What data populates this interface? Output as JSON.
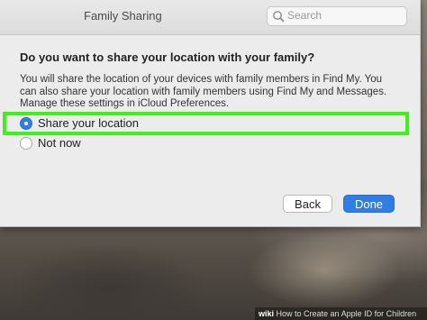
{
  "window": {
    "title": "Family Sharing",
    "search": {
      "placeholder": "Search"
    }
  },
  "prompt": {
    "heading": "Do you want to share your location with your family?",
    "description": "You will share the location of your devices with family members in Find My. You can also share your location with family members using Find My and Messages. Manage these settings in iCloud Preferences."
  },
  "options": [
    {
      "label": "Share your location",
      "selected": true
    },
    {
      "label": "Not now",
      "selected": false
    }
  ],
  "buttons": {
    "back_label": "Back",
    "done_label": "Done"
  },
  "watermark": {
    "brand": "wiki",
    "text": "How to Create an Apple ID for Children"
  },
  "colors": {
    "accent": "#2f7ee6",
    "highlight": "#3ff01a"
  }
}
